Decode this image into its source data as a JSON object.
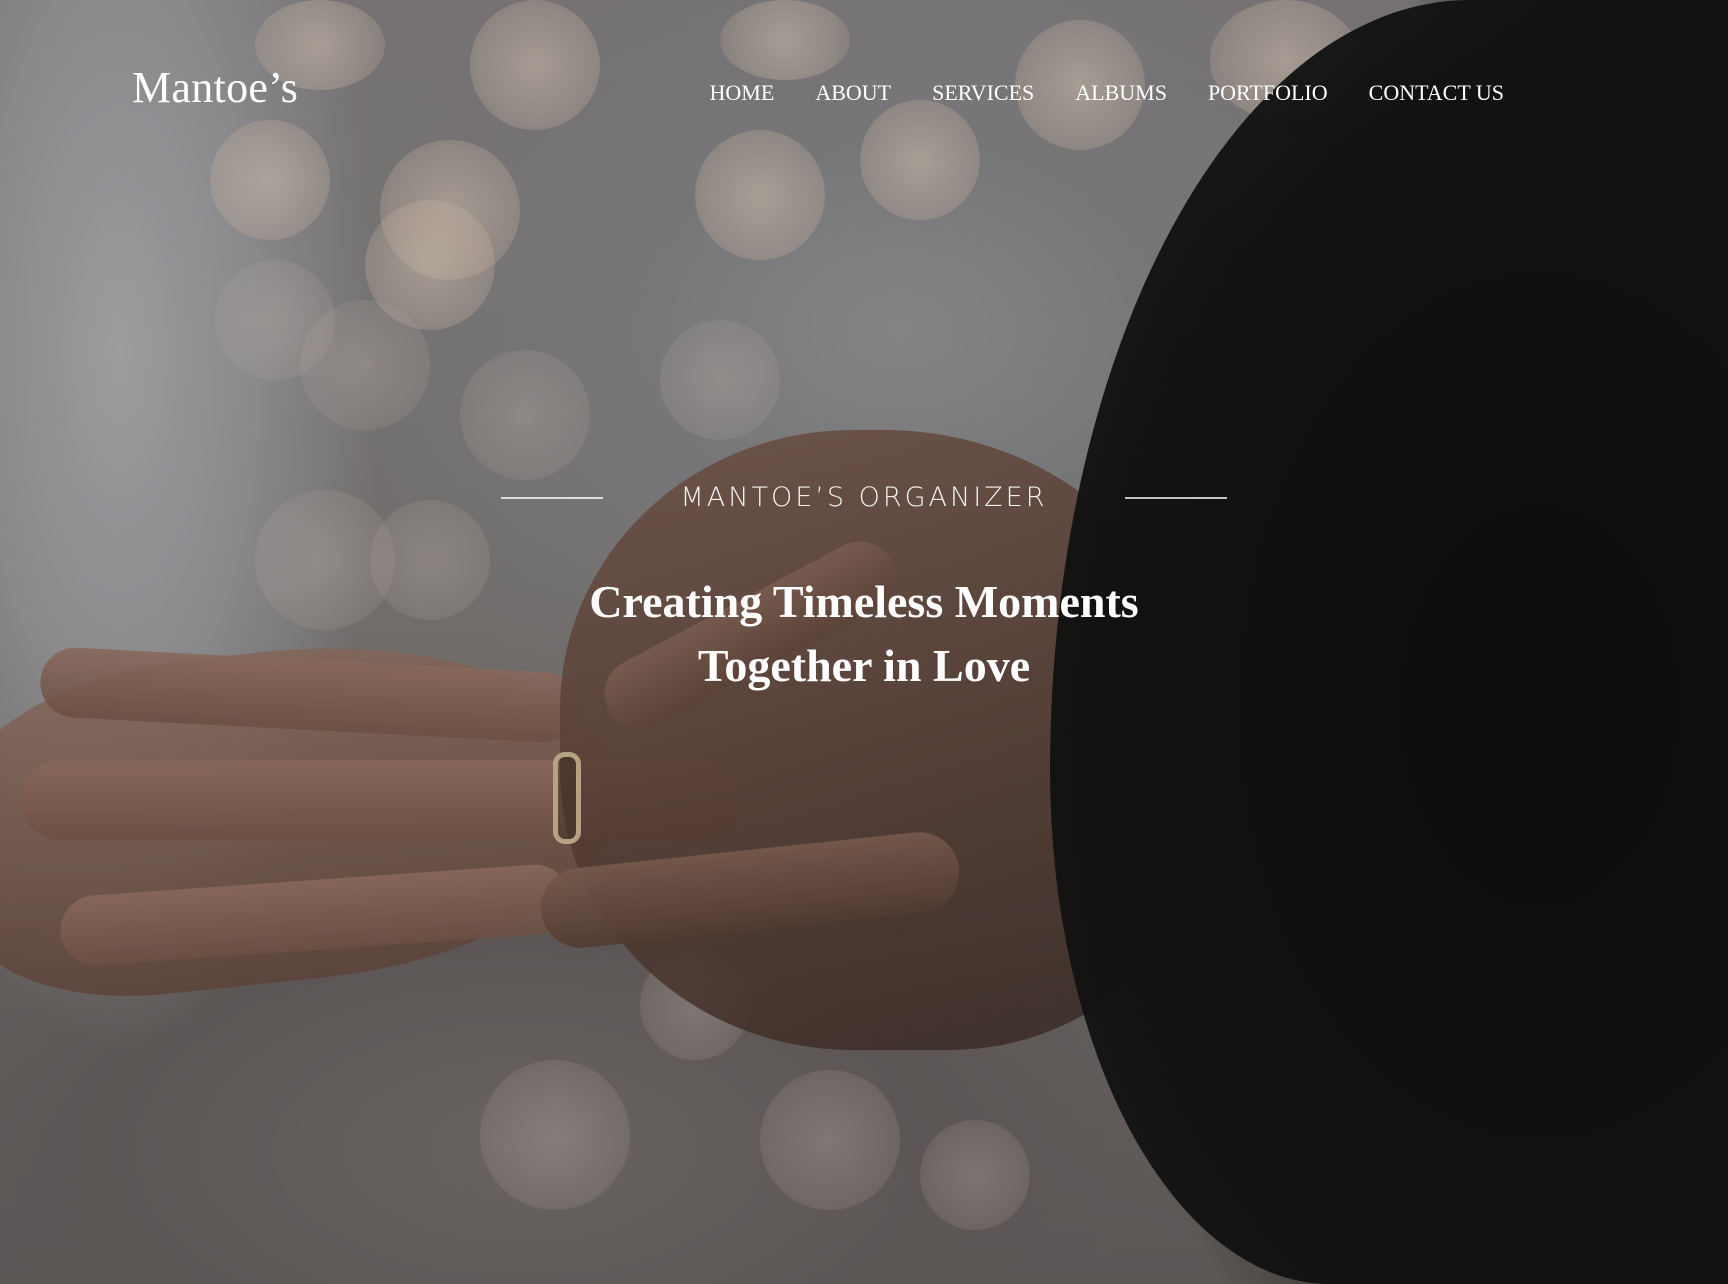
{
  "header": {
    "brand": "Mantoe’s",
    "nav": [
      {
        "label": "HOME"
      },
      {
        "label": "ABOUT"
      },
      {
        "label": "SERVICES"
      },
      {
        "label": "ALBUMS"
      },
      {
        "label": "PORTFOLIO"
      },
      {
        "label": "CONTACT US"
      }
    ]
  },
  "hero": {
    "tagline": "MANTOE’S ORGANIZER",
    "headline_line1": "Creating Timeless Moments",
    "headline_line2": "Together in Love"
  }
}
